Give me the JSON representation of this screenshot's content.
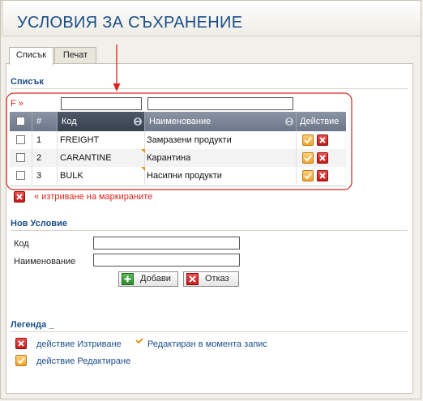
{
  "page": {
    "title": "УСЛОВИЯ ЗА СЪХРАНЕНИЕ"
  },
  "tabs": [
    {
      "label": "Списък"
    },
    {
      "label": "Печат"
    }
  ],
  "list": {
    "section_title": "Списък",
    "filter_label": "F »",
    "filter_code_value": "",
    "filter_name_value": "",
    "columns": {
      "num": "#",
      "code": "Код",
      "name": "Наименование",
      "action": "Действие"
    },
    "rows": [
      {
        "num": "1",
        "code": "FREIGHT",
        "name": "Замразени продукти"
      },
      {
        "num": "2",
        "code": "CARANTINE",
        "name": "Карантина"
      },
      {
        "num": "3",
        "code": "BULK",
        "name": "Насипни продукти"
      }
    ],
    "delete_marked_label": "« изтриване на маркираните"
  },
  "new_condition": {
    "section_title": "Нов Условие",
    "code_label": "Код",
    "name_label": "Наименование",
    "code_value": "",
    "name_value": "",
    "add_label": "Добави",
    "cancel_label": "Отказ"
  },
  "legend": {
    "section_title": "Легенда _",
    "delete_action": "действие Изтриване",
    "edited_now": "Редактиран в момента запис",
    "edit_action": "действие Редактиране"
  },
  "colors": {
    "title": "#1a4e8a",
    "annotation": "#d9251c",
    "edit_icon": "#f2a32a",
    "delete_icon": "#c81818"
  },
  "icons": {
    "edit": "checkmark-edit-icon",
    "delete": "x-delete-icon",
    "sort": "sort-arrows-icon",
    "add": "plus-icon"
  }
}
